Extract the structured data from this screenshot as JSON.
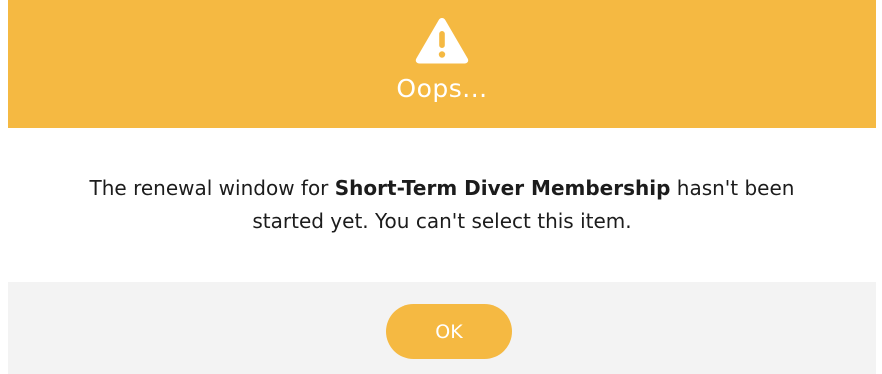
{
  "header": {
    "icon": "warning-triangle-icon",
    "title": "Oops..."
  },
  "message": {
    "before": "The renewal window for ",
    "item_name": "Short-Term Diver Membership",
    "after_line1": " hasn't been",
    "line2": "started yet. You can't select this item."
  },
  "footer": {
    "ok_label": "OK"
  },
  "colors": {
    "accent": "#f5b942",
    "footer_bg": "#f3f3f3",
    "text": "#1c1c1c"
  }
}
